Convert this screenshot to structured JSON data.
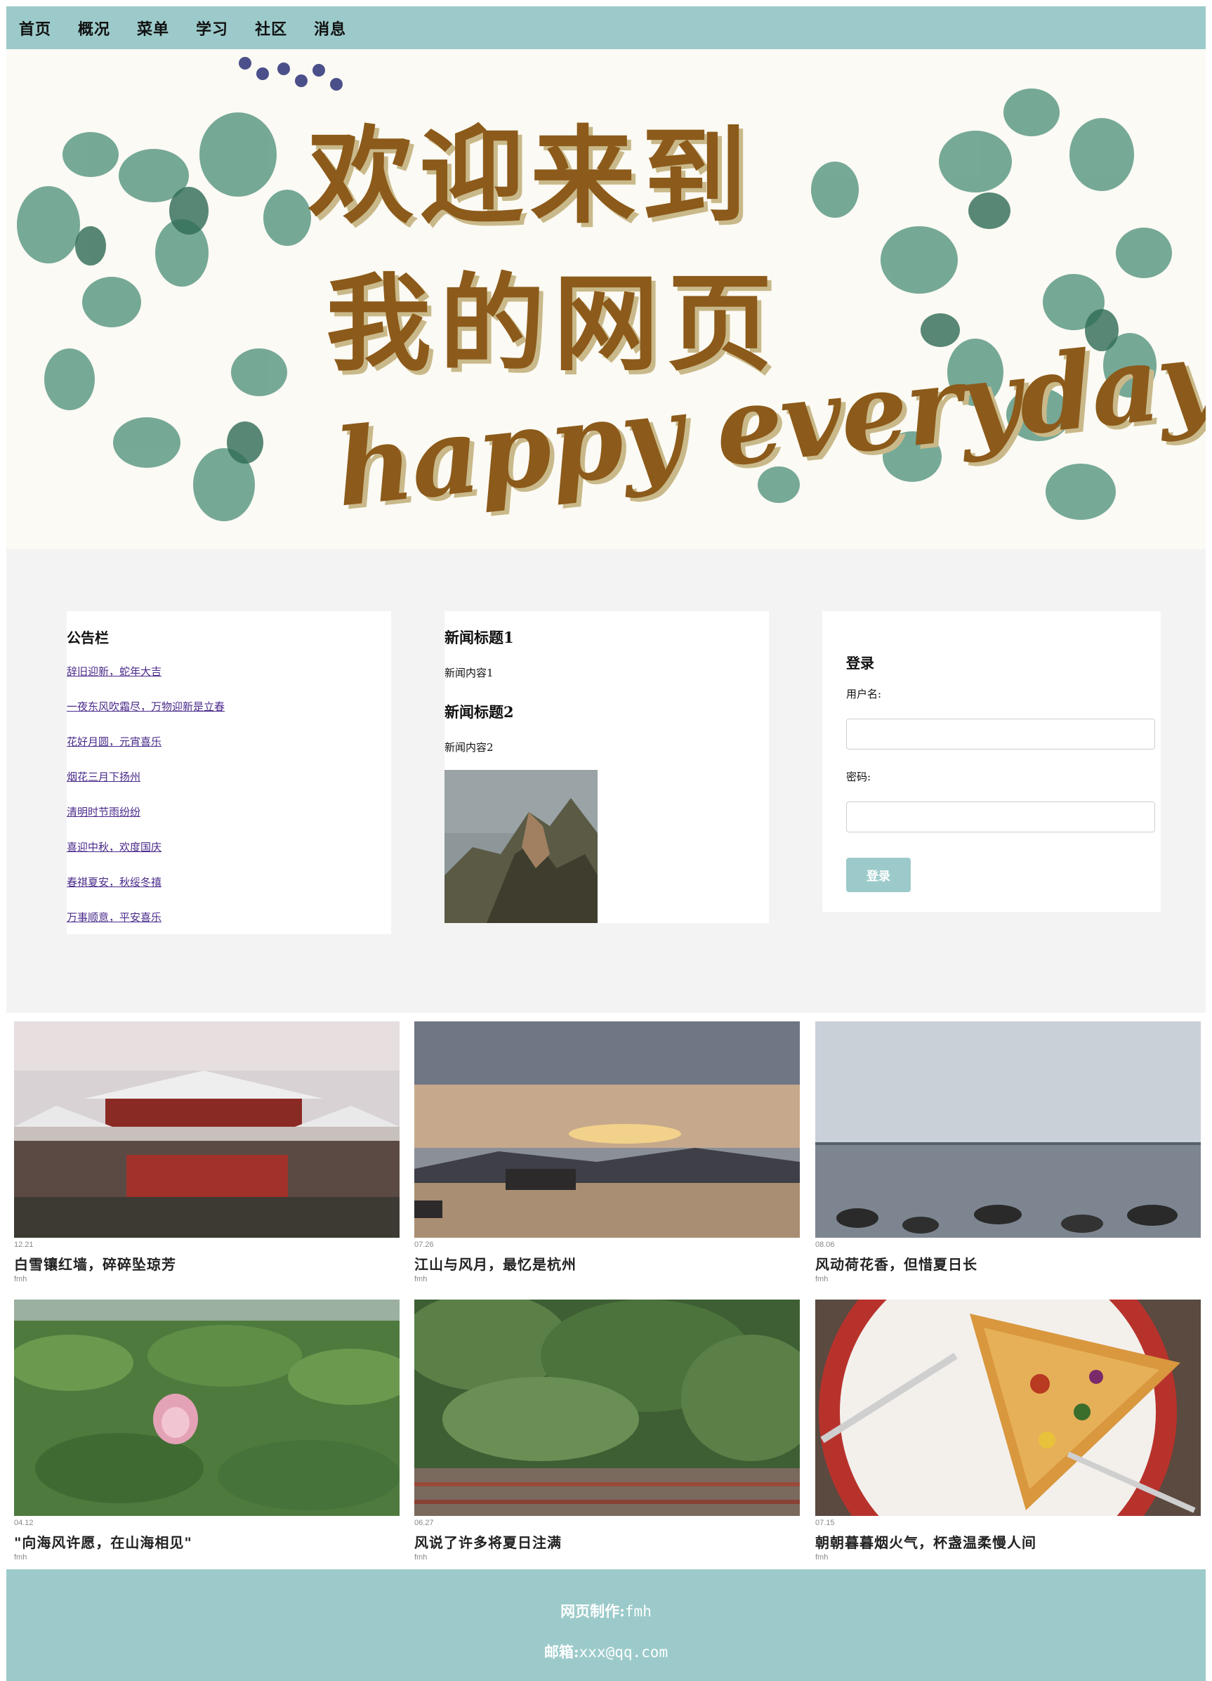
{
  "nav": {
    "items": [
      {
        "label": "首页"
      },
      {
        "label": "概况"
      },
      {
        "label": "菜单"
      },
      {
        "label": "学习"
      },
      {
        "label": "社区"
      },
      {
        "label": "消息"
      }
    ]
  },
  "banner": {
    "line1": "欢迎来到",
    "line2": "我的网页",
    "line3": "happy everyday"
  },
  "notice": {
    "title": "公告栏",
    "links": [
      "辞旧迎新，蛇年大吉",
      "一夜东风吹霜尽，万物迎新是立春",
      "花好月圆，元宵喜乐",
      "烟花三月下扬州",
      "清明时节雨纷纷",
      "喜迎中秋，欢度国庆",
      "春祺夏安，秋绥冬禧",
      "万事顺意，平安喜乐"
    ]
  },
  "news": {
    "items": [
      {
        "title": "新闻标题1",
        "body": "新闻内容1"
      },
      {
        "title": "新闻标题2",
        "body": "新闻内容2"
      }
    ]
  },
  "login": {
    "title": "登录",
    "username_label": "用户名:",
    "password_label": "密码:",
    "username_value": "",
    "password_value": "",
    "button_label": "登录"
  },
  "gallery": {
    "tiles": [
      {
        "date": "12.21",
        "caption": "白雪镶红墙，碎碎坠琼芳",
        "author": "fmh"
      },
      {
        "date": "07.26",
        "caption": "江山与风月，最忆是杭州",
        "author": "fmh"
      },
      {
        "date": "08.06",
        "caption": "风动荷花香，但惜夏日长",
        "author": "fmh"
      },
      {
        "date": "04.12",
        "caption": "\"向海风许愿，在山海相见\"",
        "author": "fmh"
      },
      {
        "date": "06.27",
        "caption": "风说了许多将夏日注满",
        "author": "fmh"
      },
      {
        "date": "07.15",
        "caption": "朝朝暮暮烟火气，杯盏温柔慢人间",
        "author": "fmh"
      }
    ]
  },
  "footer": {
    "maker_label": "网页制作:",
    "maker_value": "fmh",
    "email_label": "邮箱:",
    "email_value": "xxx@qq.com"
  },
  "colors": {
    "accent": "#9ccaca",
    "banner_text": "#8c5a1a",
    "section_bg": "#f3f3f3"
  }
}
